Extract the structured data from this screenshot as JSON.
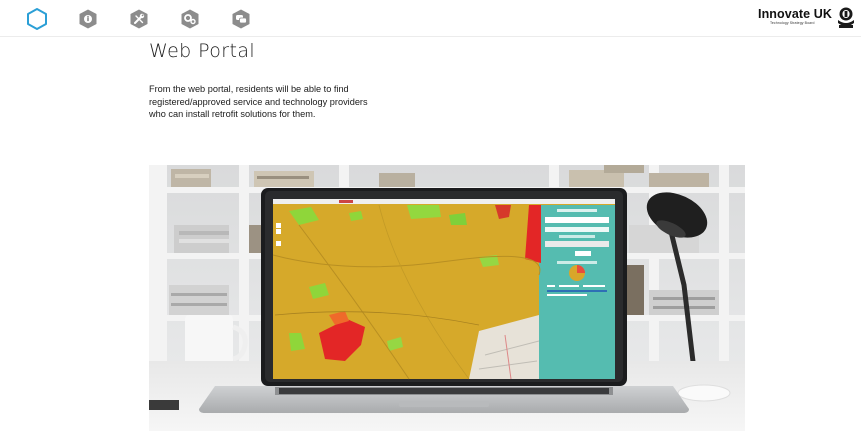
{
  "nav": {
    "items": [
      {
        "name": "home",
        "icon": "hexagon-outline-icon",
        "active": true
      },
      {
        "name": "info",
        "icon": "info-hexagon-icon"
      },
      {
        "name": "tools",
        "icon": "tools-icon"
      },
      {
        "name": "settings",
        "icon": "gears-icon"
      },
      {
        "name": "contact",
        "icon": "chat-bubbles-icon"
      }
    ],
    "accent": "#2b9fd6",
    "inactive": "#8c8c8c"
  },
  "brand": {
    "name": "Innovate UK",
    "subtitle": "Technology Strategy Board",
    "crest_icon": "royal-crest-icon"
  },
  "page": {
    "title": "Web Portal",
    "intro_lines": [
      "From the web portal, residents will be able to find",
      "registered/approved service and technology providers",
      "who can install retrofit solutions for them."
    ]
  },
  "photo": {
    "subject": "laptop-with-web-portal-map",
    "map_colors": {
      "base": "#d8ad2b",
      "highlight_green": "#8fd63a",
      "highlight_red": "#e32626",
      "side_panel": "#4fb8ad"
    }
  }
}
